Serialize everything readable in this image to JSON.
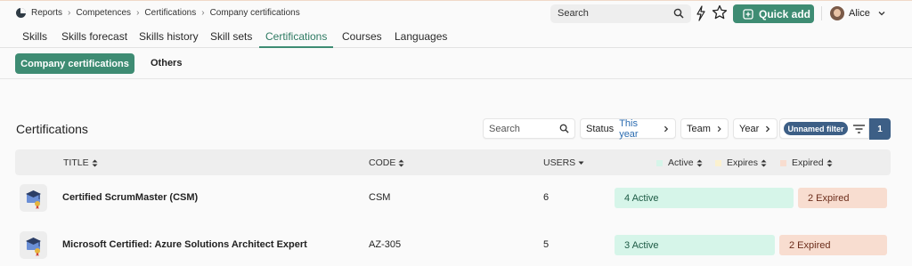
{
  "breadcrumb": [
    "Reports",
    "Competences",
    "Certifications",
    "Company certifications"
  ],
  "top": {
    "search_placeholder": "Search",
    "quick_add_label": "Quick add",
    "user_name": "Alice"
  },
  "tabs": [
    {
      "label": "Skills"
    },
    {
      "label": "Skills forecast"
    },
    {
      "label": "Skills history"
    },
    {
      "label": "Skill sets"
    },
    {
      "label": "Certifications"
    },
    {
      "label": "Courses"
    },
    {
      "label": "Languages"
    }
  ],
  "active_tab": "Certifications",
  "subtabs": {
    "active": "Company certifications",
    "other": "Others"
  },
  "section": {
    "title": "Certifications",
    "search_placeholder": "Search",
    "status_label": "Status",
    "status_value": "This year",
    "team_label": "Team",
    "year_label": "Year",
    "unnamed_filter": "Unnamed filter",
    "filter_count": "1"
  },
  "table": {
    "headers": {
      "title": "TITLE",
      "code": "CODE",
      "users": "USERS",
      "active": "Active",
      "expires": "Expires",
      "expired": "Expired"
    },
    "rows": [
      {
        "title": "Certified ScrumMaster (CSM)",
        "code": "CSM",
        "users": "6",
        "active": "4 Active",
        "expired": "2 Expired",
        "active_fraction": 0.667
      },
      {
        "title": "Microsoft Certified: Azure Solutions Architect Expert",
        "code": "AZ-305",
        "users": "5",
        "active": "3 Active",
        "expired": "2 Expired",
        "active_fraction": 0.6
      }
    ]
  },
  "colors": {
    "accent": "#3e8c73",
    "filter_badge": "#3d5f86",
    "active_bg": "#d6f5e9",
    "expires_bg": "#fbf1cf",
    "expired_bg": "#f8ddd0"
  },
  "icons": [
    "company-logo-icon",
    "search-icon",
    "bolt-icon",
    "star-icon",
    "quick-add-icon",
    "avatar",
    "chevron-down-icon",
    "chevron-right-icon",
    "filter-lines-icon",
    "sort-icon",
    "certificate-icon"
  ]
}
